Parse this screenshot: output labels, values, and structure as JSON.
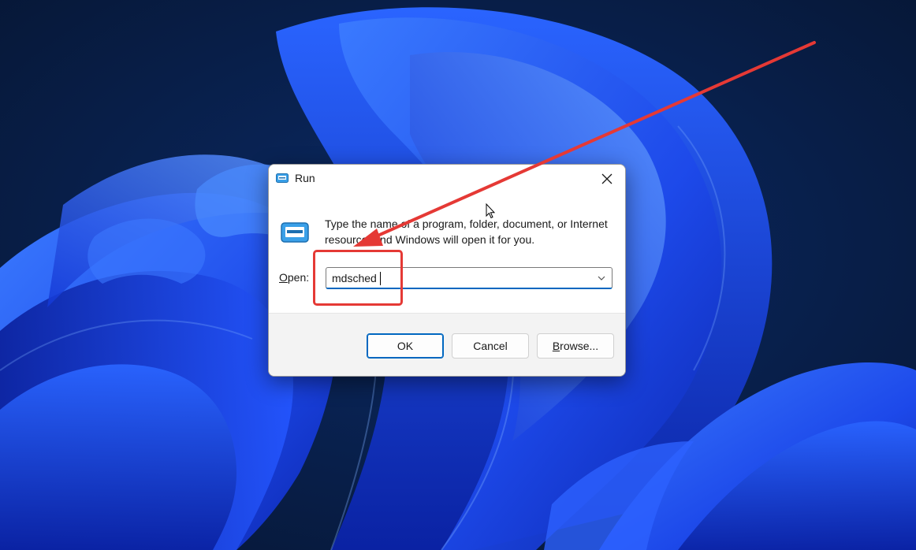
{
  "dialog": {
    "title": "Run",
    "description": "Type the name of a program, folder, document, or Internet resource, and Windows will open it for you.",
    "open_label_underlined": "O",
    "open_label_rest": "pen:",
    "open_value": "mdsched",
    "buttons": {
      "ok": "OK",
      "cancel": "Cancel",
      "browse_underlined": "B",
      "browse_rest": "rowse..."
    }
  },
  "icons": {
    "title": "run-icon",
    "large": "run-icon",
    "close": "close-icon",
    "dropdown": "chevron-down-icon",
    "cursor": "mouse-pointer-icon"
  },
  "colors": {
    "annotation": "#e53935",
    "accent": "#0067c0",
    "wallpaper_dark": "#071a3a",
    "wallpaper_blue": "#1f4ff0"
  }
}
